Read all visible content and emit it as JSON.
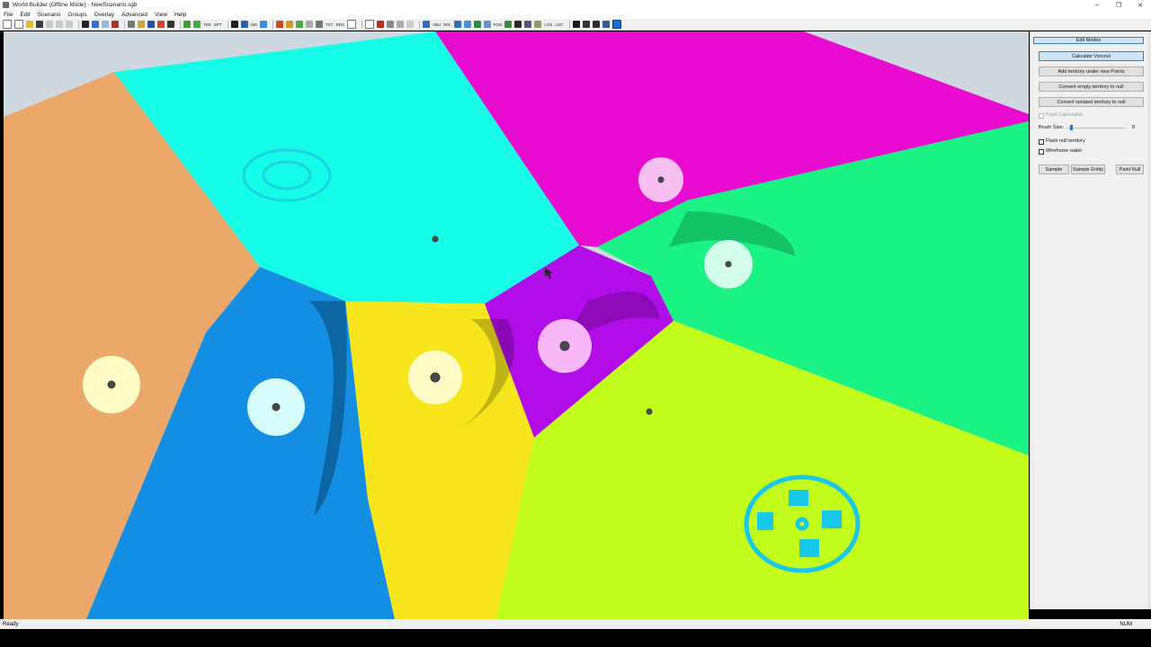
{
  "window": {
    "title": "World Builder (Offline Mode) - NewScenario.sgb",
    "controls": {
      "minimize": "–",
      "maximize": "❐",
      "close": "✕"
    }
  },
  "menu": [
    "File",
    "Edit",
    "Scenario",
    "Groups",
    "Overlay",
    "Advanced",
    "View",
    "Help"
  ],
  "toolbar": {
    "labels": [
      "TKE",
      "SPT",
      "NIS",
      "TXT",
      "REG",
      "OBJ",
      "SPL",
      "FOG",
      "LOS",
      "LOC"
    ]
  },
  "panel": {
    "edit_modes": "Edit Modes",
    "calculate_voronoi": "Calculate Voronoi",
    "add_territory": "Add territory under new Points",
    "convert_empty": "Convert empty territory to null",
    "convert_isolated": "Convert isolated territory to null",
    "paint_capturable": "Paint Capturable",
    "brush_size_label": "Brush Size:",
    "brush_size_value": "8",
    "flash_null": "Flash null territory",
    "wireframe_water": "Wireframe water",
    "sample": "Sample",
    "sample_entity": "Sample Entity",
    "paint_null": "Paint Null"
  },
  "status": {
    "text": "Ready",
    "num": "NUM"
  },
  "territory_colors": {
    "orange": "#ECA86A",
    "cyan": "#15FDE6",
    "magenta": "#E90BD0",
    "green": "#1AF383",
    "blue": "#138EE3",
    "yellow": "#F8E61C",
    "purple": "#B10DE8",
    "lime": "#C2FC1B"
  }
}
